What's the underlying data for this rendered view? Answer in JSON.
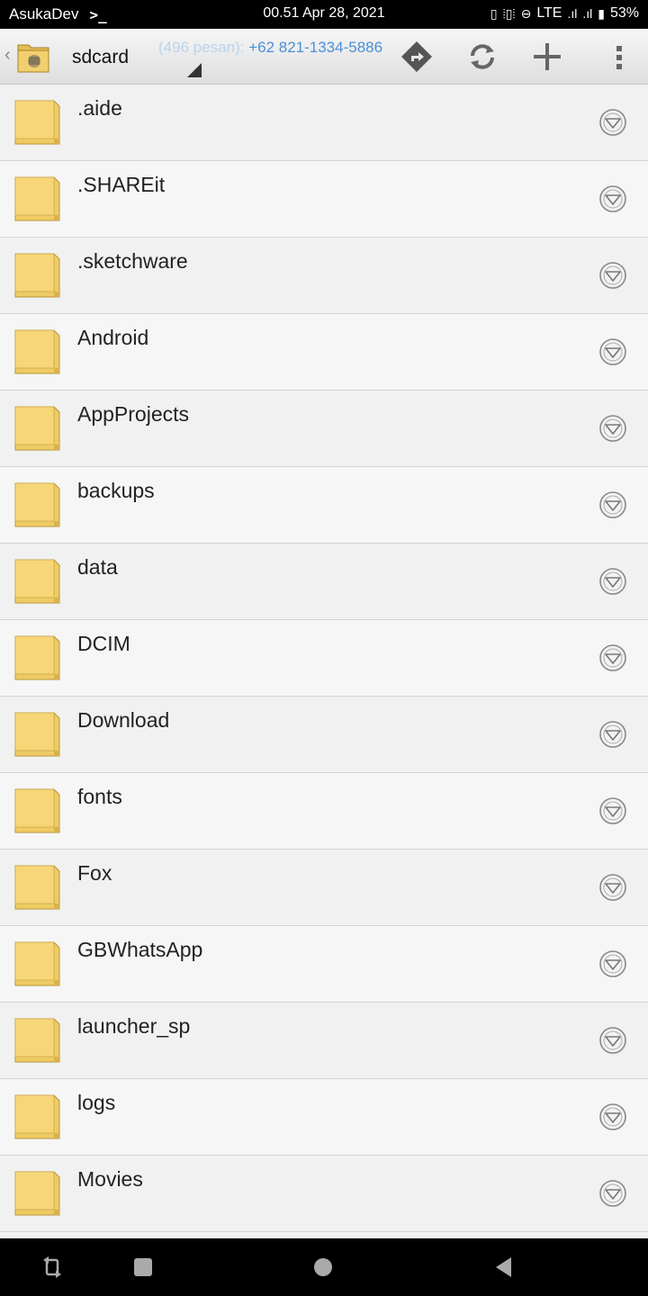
{
  "status_bar": {
    "carrier": "AsukaDev",
    "time_date": "00.51 Apr 28, 2021",
    "network": "LTE",
    "battery": "53%"
  },
  "action_bar": {
    "location": "sdcard",
    "ticker_faded": "(496 pesan): ",
    "ticker_text": "+62 821-1334-5886"
  },
  "files": [
    {
      "name": ".aide"
    },
    {
      "name": ".SHAREit"
    },
    {
      "name": ".sketchware"
    },
    {
      "name": "Android"
    },
    {
      "name": "AppProjects"
    },
    {
      "name": "backups"
    },
    {
      "name": "data"
    },
    {
      "name": "DCIM"
    },
    {
      "name": "Download"
    },
    {
      "name": "fonts"
    },
    {
      "name": "Fox"
    },
    {
      "name": "GBWhatsApp"
    },
    {
      "name": "launcher_sp"
    },
    {
      "name": "logs"
    },
    {
      "name": "Movies"
    }
  ],
  "icons": {
    "folder": "folder-icon",
    "menu": "context-menu-icon",
    "navigate": "navigate-icon",
    "refresh": "refresh-icon",
    "add": "add-icon",
    "overflow": "overflow-menu-icon"
  },
  "colors": {
    "folder_fill": "#f2cf6e",
    "ticker": "#4a90d9",
    "status_bar": "#000000"
  }
}
